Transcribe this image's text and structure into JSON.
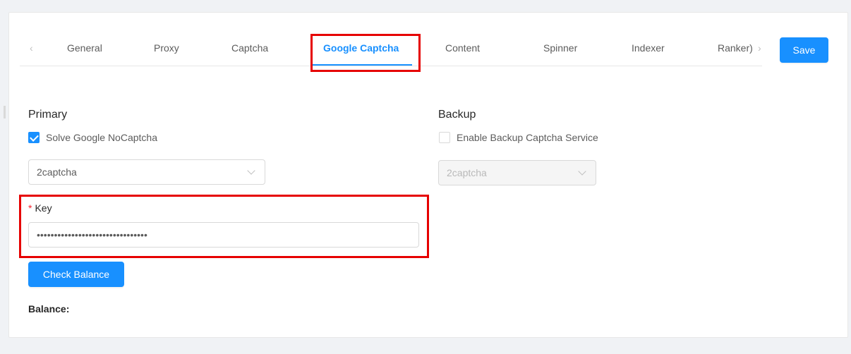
{
  "tabs": {
    "prev_icon": "‹",
    "next_icon": "›",
    "items": [
      {
        "label": "General"
      },
      {
        "label": "Proxy"
      },
      {
        "label": "Captcha"
      },
      {
        "label": "Google Captcha",
        "active": true
      },
      {
        "label": "Content"
      },
      {
        "label": "Spinner"
      },
      {
        "label": "Indexer"
      },
      {
        "label": "Ranker)"
      }
    ]
  },
  "toolbar": {
    "save_label": "Save"
  },
  "primary": {
    "title": "Primary",
    "checkbox_label": "Solve Google NoCaptcha",
    "checked": true,
    "service": "2captcha",
    "key_required_mark": "*",
    "key_label": "Key",
    "key_value": "••••••••••••••••••••••••••••••••",
    "check_balance_label": "Check Balance",
    "balance_label": "Balance:"
  },
  "backup": {
    "title": "Backup",
    "checkbox_label": "Enable Backup Captcha Service",
    "checked": false,
    "service": "2captcha"
  },
  "colors": {
    "accent": "#1890ff",
    "highlight": "#e60000",
    "required": "#f5222d"
  }
}
